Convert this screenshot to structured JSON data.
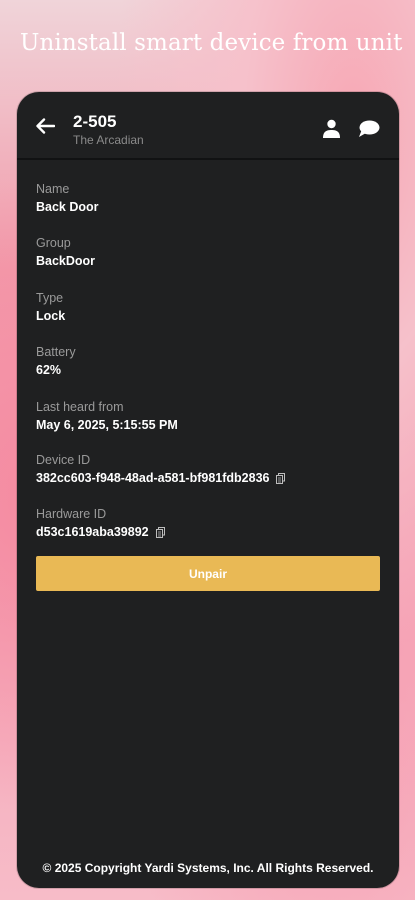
{
  "headline": "Uninstall smart device from unit",
  "header": {
    "title": "2-505",
    "subtitle": "The Arcadian",
    "back_icon": "back-arrow-icon",
    "person_icon": "person-icon",
    "chat_icon": "chat-bubble-icon"
  },
  "fields": [
    {
      "label": "Name",
      "value": "Back Door"
    },
    {
      "label": "Group",
      "value": "BackDoor"
    },
    {
      "label": "Type",
      "value": "Lock"
    },
    {
      "label": "Battery",
      "value": "62%"
    },
    {
      "label": "Last heard from",
      "value": "May 6, 2025, 5:15:55 PM"
    },
    {
      "label": "Device ID",
      "value": "382cc603-f948-48ad-a581-bf981fdb2836"
    },
    {
      "label": "Hardware ID",
      "value": "d53c1619aba39892"
    }
  ],
  "unpair_label": "Unpair",
  "footer": "© 2025 Copyright Yardi Systems, Inc. All Rights Reserved.",
  "colors": {
    "accent": "#e9b955",
    "panel": "#1f2021",
    "label": "#9a9a9a"
  }
}
